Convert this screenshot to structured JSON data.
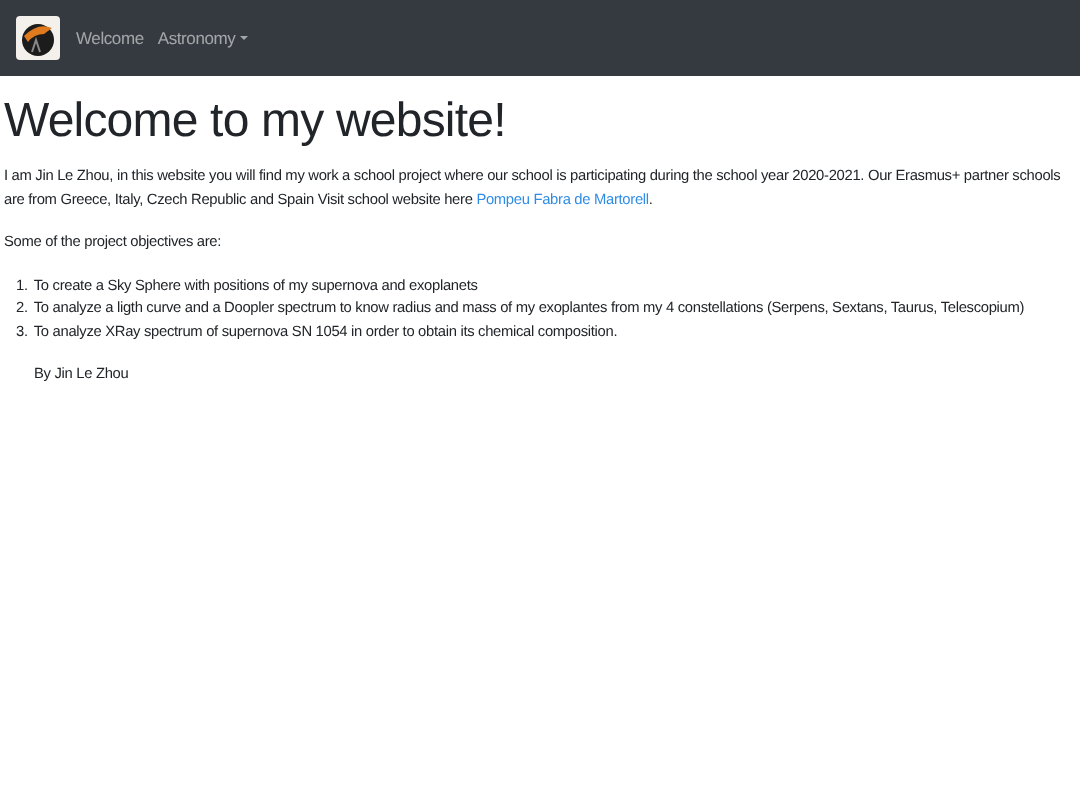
{
  "navbar": {
    "links": [
      {
        "label": "Welcome",
        "kind": "link"
      },
      {
        "label": "Astronomy",
        "kind": "dropdown"
      }
    ]
  },
  "heading": "Welcome to my website!",
  "intro": {
    "text": "I am Jin Le Zhou, in this website you will find my work a school project where our school is participating during the school year 2020-2021. Our Erasmus+ partner schools are from Greece, Italy, Czech Republic and Spain Visit school website here ",
    "link": "Pompeu Fabra de Martorell",
    "after": "."
  },
  "objectives_intro": "Some of the project objectives are:",
  "objectives": [
    {
      "number": "1.",
      "text": "To create a Sky Sphere with positions of my supernova and exoplanets"
    },
    {
      "number": "2.",
      "text": "To analyze a ligth curve and a Doopler spectrum to know radius and mass of my exoplantes from my 4 constellations (Serpens, Sextans, Taurus, Telescopium)"
    },
    {
      "number": "3.",
      "text": "To analyze XRay spectrum of supernova SN 1054 in order to obtain its chemical composition."
    }
  ],
  "signature": "By Jin Le Zhou"
}
